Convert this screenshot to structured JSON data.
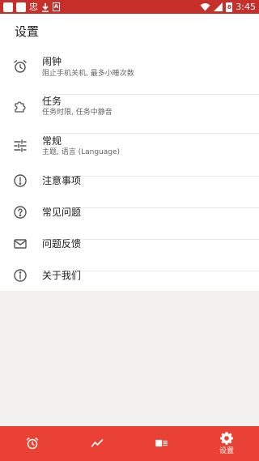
{
  "statusbar": {
    "left_glyph": "忠",
    "battery_level": "8",
    "time": "3:45"
  },
  "page": {
    "title": "设置"
  },
  "settings": [
    {
      "title": "闹钟",
      "subtitle": "阻止手机关机, 最多小睡次数",
      "icon": "alarm-clock-icon"
    },
    {
      "title": "任务",
      "subtitle": "任务时限, 任务中静音",
      "icon": "puzzle-icon"
    },
    {
      "title": "常规",
      "subtitle": "主题, 语言 (Language)",
      "icon": "sliders-icon"
    },
    {
      "title": "注意事项",
      "icon": "exclamation-circle-icon"
    },
    {
      "title": "常见问题",
      "icon": "question-circle-icon"
    },
    {
      "title": "问题反馈",
      "icon": "envelope-icon"
    },
    {
      "title": "关于我们",
      "icon": "info-circle-icon"
    }
  ],
  "bottom_nav": {
    "tabs": [
      {
        "icon": "alarm-clock-icon",
        "label": ""
      },
      {
        "icon": "trend-chart-icon",
        "label": ""
      },
      {
        "icon": "news-card-icon",
        "label": ""
      },
      {
        "icon": "gear-icon",
        "label": "设置",
        "active": true
      }
    ]
  },
  "colors": {
    "statusbar": "#c7302a",
    "bottom_bar": "#e94235",
    "page_background": "#f2f1f0",
    "panel_background": "#ffffff"
  }
}
